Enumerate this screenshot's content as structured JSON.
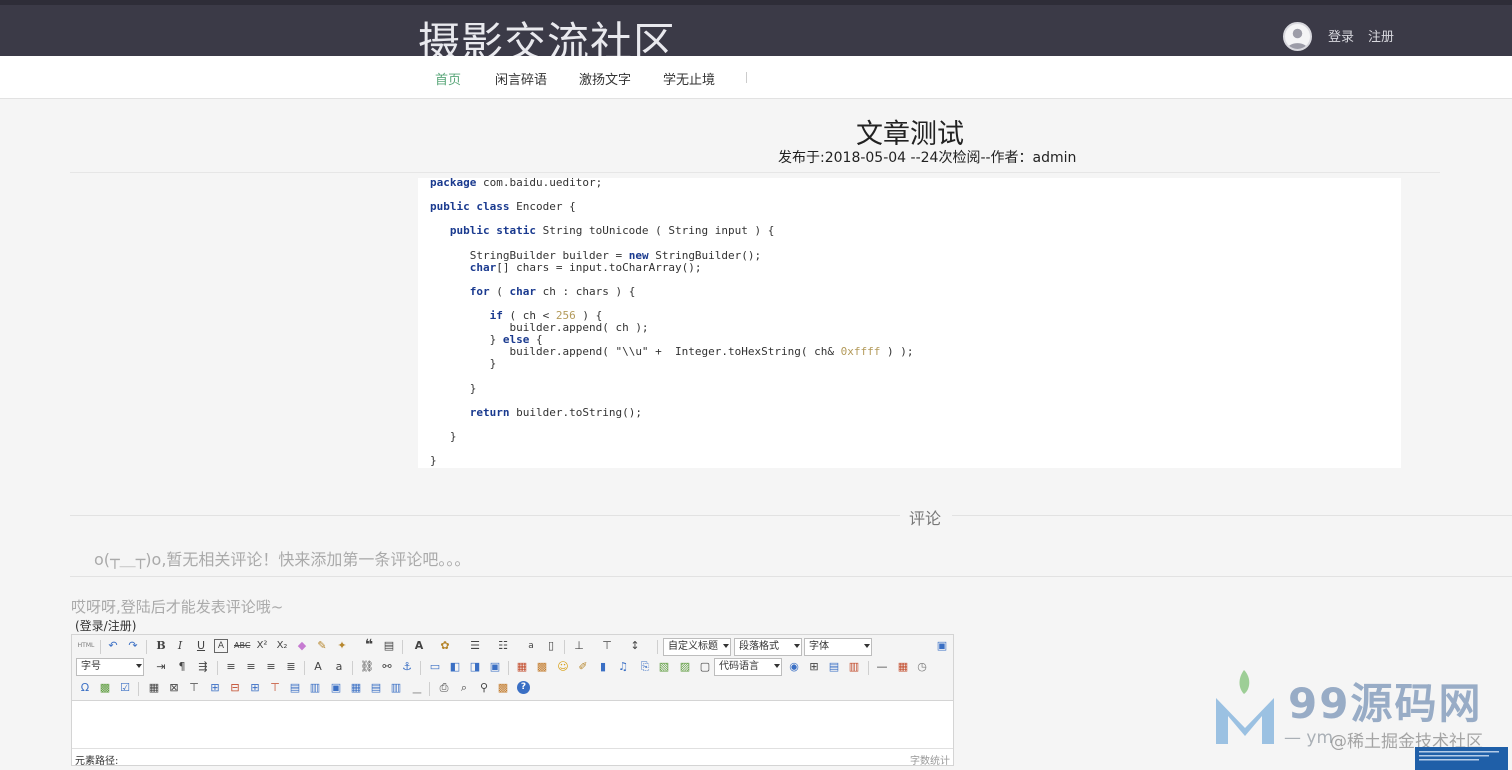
{
  "header": {
    "site_title": "摄影交流社区",
    "login": "登录",
    "register": "注册"
  },
  "nav": {
    "items": [
      "首页",
      "闲言碎语",
      "激扬文字",
      "学无止境"
    ]
  },
  "article": {
    "title": "文章测试",
    "meta": "发布于:2018-05-04 --24次检阅--作者：admin"
  },
  "code": {
    "lines": [
      "package com.baidu.ueditor;",
      "public class Encoder {",
      "   public static String toUnicode ( String input ) {",
      "      StringBuilder builder = new StringBuilder();",
      "      char[] chars = input.toCharArray();",
      "      for ( char ch : chars ) {",
      "         if ( ch < 256 ) {",
      "            builder.append( ch );",
      "         } else {",
      "            builder.append( \"\\\\u\" +  Integer.toHexString( ch& 0xffff ) );",
      "         }",
      "      }",
      "      return builder.toString();",
      "   }",
      "}"
    ]
  },
  "comments": {
    "heading": "评论",
    "empty_text": "o(┬＿┬)o,暂无相关评论！快来添加第一条评论吧。。。",
    "login_tip": "哎呀呀,登陆后才能发表评论哦~",
    "login_register": "(登录/注册)"
  },
  "editor": {
    "selects": {
      "custom_heading": "自定义标题",
      "paragraph_format": "段落格式",
      "font_family": "字体",
      "font_size": "字号",
      "code_language": "代码语言"
    },
    "status_path_label": "元素路径:",
    "word_count_label": "字数统计"
  },
  "watermark": {
    "brand": "99源码网",
    "sub": "— ym",
    "sub2": "@稀土掘金技术社区"
  },
  "colors": {
    "header_bg": "#3b3a47",
    "nav_active": "#5aa77a",
    "keyword": "#1a3a8f",
    "number": "#b39a5a"
  }
}
